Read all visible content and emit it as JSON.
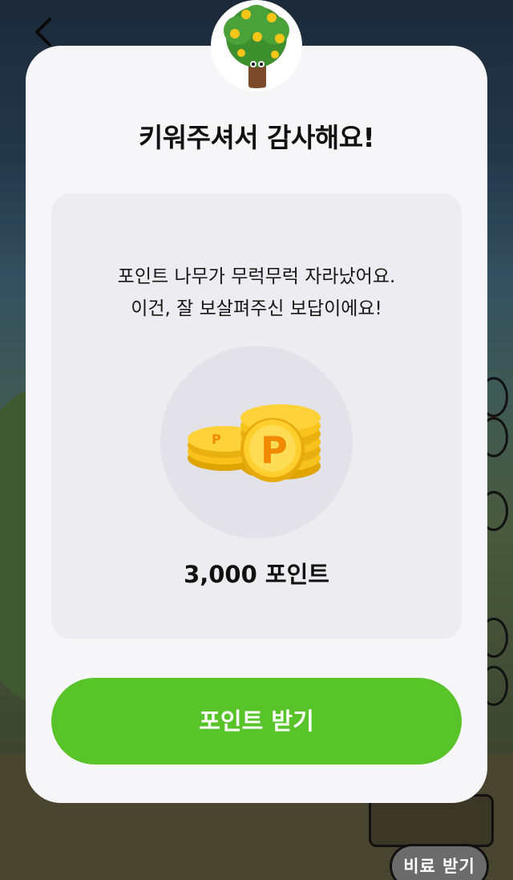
{
  "modal": {
    "title": "키워주셔서 감사해요!",
    "message_line1": "포인트 나무가 무럭무럭 자라났어요.",
    "message_line2": "이건, 잘 보살펴주신 보답이에요!",
    "reward_amount": "3,000 포인트",
    "claim_button_label": "포인트 받기",
    "avatar_icon": "money-tree-icon",
    "reward_icon": "point-coins-icon"
  },
  "background": {
    "later_button_label": "비료 받기",
    "back_icon": "chevron-left-icon"
  },
  "colors": {
    "accent_green": "#58c42a",
    "modal_bg": "#f6f6f8",
    "card_bg": "#ededf1",
    "coin_gold": "#f5c518"
  }
}
